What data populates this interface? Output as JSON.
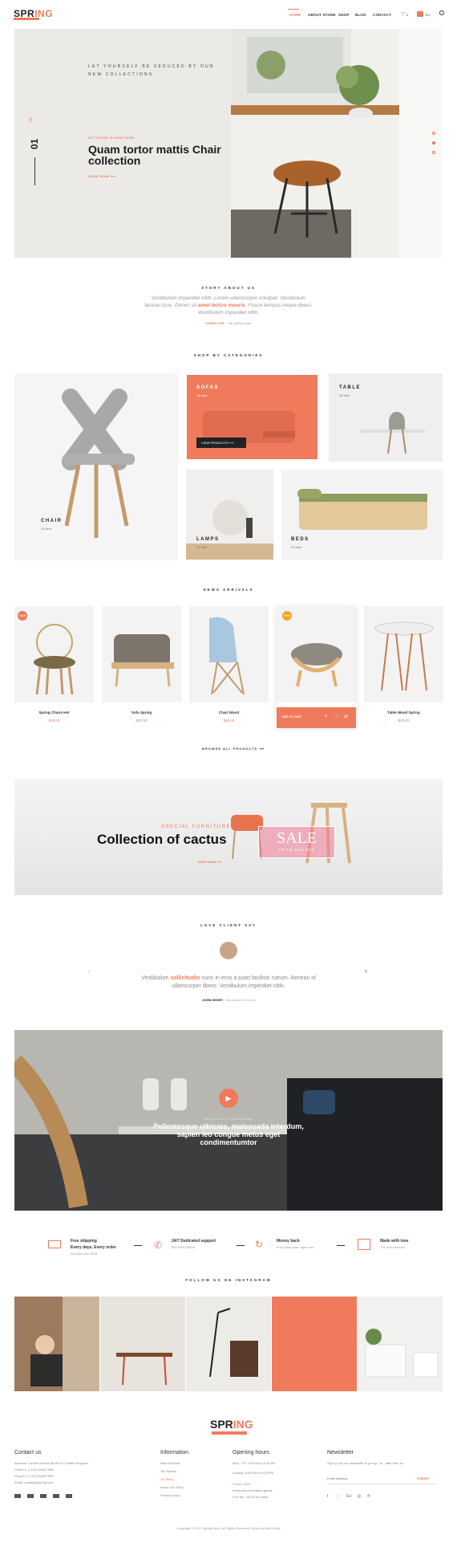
{
  "header": {
    "logo_a": "SPR",
    "logo_b": "ING",
    "nav": [
      "HOME",
      "ABOUT STORE",
      "SHOP",
      "BLOG",
      "CONTACT"
    ],
    "wishlist_count": "0",
    "cart_label": "$ 0"
  },
  "hero": {
    "tagline": "LET YOURSELF BE SEDUCED BY OUR NEW COLLECTIONS",
    "slide_num": "01",
    "slide_total": "04",
    "small": "ATTITUDE FURNITURE",
    "title": "Quam tortor mattis Chair collection",
    "cta": "SHOP NOW"
  },
  "story": {
    "title": "STORY ABOUT US",
    "text_a": "Vestibulum imperdiet nibh. Lorem ullamcorper volutpat. Vestibulum lacinia risus. Donec sit ",
    "text_hl": "amet lectus mauris",
    "text_b": ". Fusce tempus neque libero. Vestibulum imperdiet nibh.",
    "sig_name": "HARRY COE",
    "sig_role": " - Top Spring Store"
  },
  "categories": {
    "title": "SHOP BY CATEGORIES",
    "items": [
      {
        "label": "CHAIR",
        "count": "24 Item"
      },
      {
        "label": "SOFAS",
        "count": "18 Item",
        "btn": "VIEW PRODUCTS"
      },
      {
        "label": "TABLE",
        "count": "36 Item"
      },
      {
        "label": "LAMPS",
        "count": "21 Item"
      },
      {
        "label": "BEDS",
        "count": "23 Item"
      }
    ]
  },
  "arrivals": {
    "title": "NEWS ARRIVALS",
    "items": [
      {
        "name": "Spring Chaire Hot",
        "price": "$20.00",
        "badge": "Sale"
      },
      {
        "name": "Sofa Spring",
        "price": "$20.00"
      },
      {
        "name": "Chair Wood",
        "price": "$20.00"
      },
      {
        "name": "",
        "price": "",
        "badge": "New",
        "cart": "ADD TO CART"
      },
      {
        "name": "Table Wood Spring",
        "price": "$20.00"
      }
    ],
    "browse": "BROWSE ALL PRODUCTS"
  },
  "banner": {
    "small": "SPECIAL FURNITURE",
    "title": "Collection of cactus",
    "sale": "SALE",
    "sale_sub": "UP TO 40% OFF",
    "cta": "SHOP NOW"
  },
  "testimonial": {
    "title": "LOVE CLIENT SAY",
    "text_a": "Vestibulum ",
    "text_hl": "sollicitudin",
    "text_b": " nunc in eros a justo facilisis rutrum. Aenean id ullamcorper libero. Vestibulum imperdiet nibh.",
    "name": "JOHN HENRY",
    "role": " - Manufacturer Studio"
  },
  "video": {
    "small": "Interiors in the spring",
    "title": "Pellentesque ultricies, malesuada interdum, sapien leo congue metus eget condimentumtor"
  },
  "services": [
    {
      "t1": "Free shipping",
      "t2": "Every days, Every order",
      "t3": "All order over $100"
    },
    {
      "t1": "24/7 Dedicated support",
      "t2": "",
      "t3": "800 9000 00606"
    },
    {
      "t1": "Money back",
      "t2": "",
      "t3": "Enim dictu diam eget eros"
    },
    {
      "t1": "Made with love",
      "t2": "",
      "t3": "The best services"
    }
  ],
  "instagram": {
    "title": "FOLLOW US ON INSTAGRAM"
  },
  "footer": {
    "logo_a": "SPR",
    "logo_b": "ING",
    "contact_h": "Contact us",
    "address": "Address: London Oxford Street 012 United Kingdom",
    "phone1": "Phone 1: (+012) 3456 7890",
    "phone2": "Phone 2: (+012) 3456 7890",
    "email": "Email: contact@spring.com",
    "info_h": "Information",
    "info_links": [
      "New Products",
      "Top Sellers",
      "Our Blog",
      "About Our Shop",
      "Privacy policy"
    ],
    "hours_h": "Opening hours",
    "hours": [
      "Mon - Fri:    7:30 AM to 8:00 PM",
      "Sunday:    8:00 AM to 6:00 PM"
    ],
    "hours_note1": "Flower Store",
    "hours_note2": "Every second related goods",
    "hours_note3": "9:00 am - 08:00 pm daily",
    "news_h": "Newsletter",
    "news_text": "Sign up for our newsletter to get up - to - date from us",
    "email_ph": "Email address",
    "submit": "SUBMIT",
    "copyright": "Copyright © 2017 Spring Store. All Rights Reserved. Made by MirrorStyle"
  }
}
